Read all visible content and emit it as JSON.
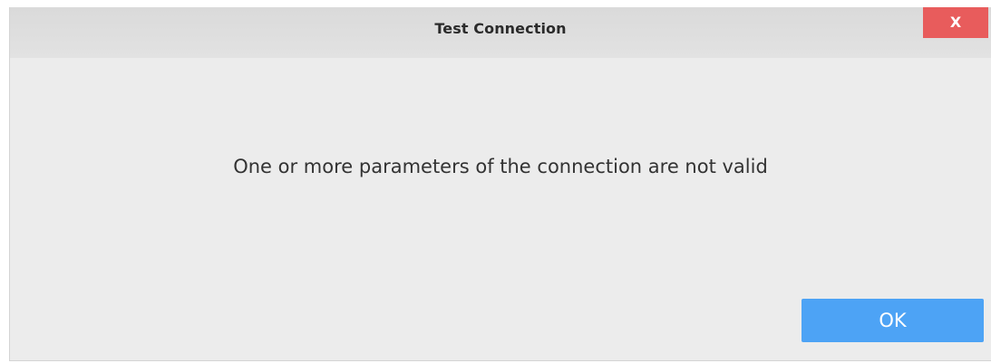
{
  "dialog": {
    "title": "Test Connection",
    "close_label": "X",
    "message": "One or more parameters of the connection are not valid",
    "ok_label": "OK"
  },
  "colors": {
    "close_button": "#e85c5c",
    "ok_button": "#4da3f5",
    "dialog_background": "#ececec"
  }
}
